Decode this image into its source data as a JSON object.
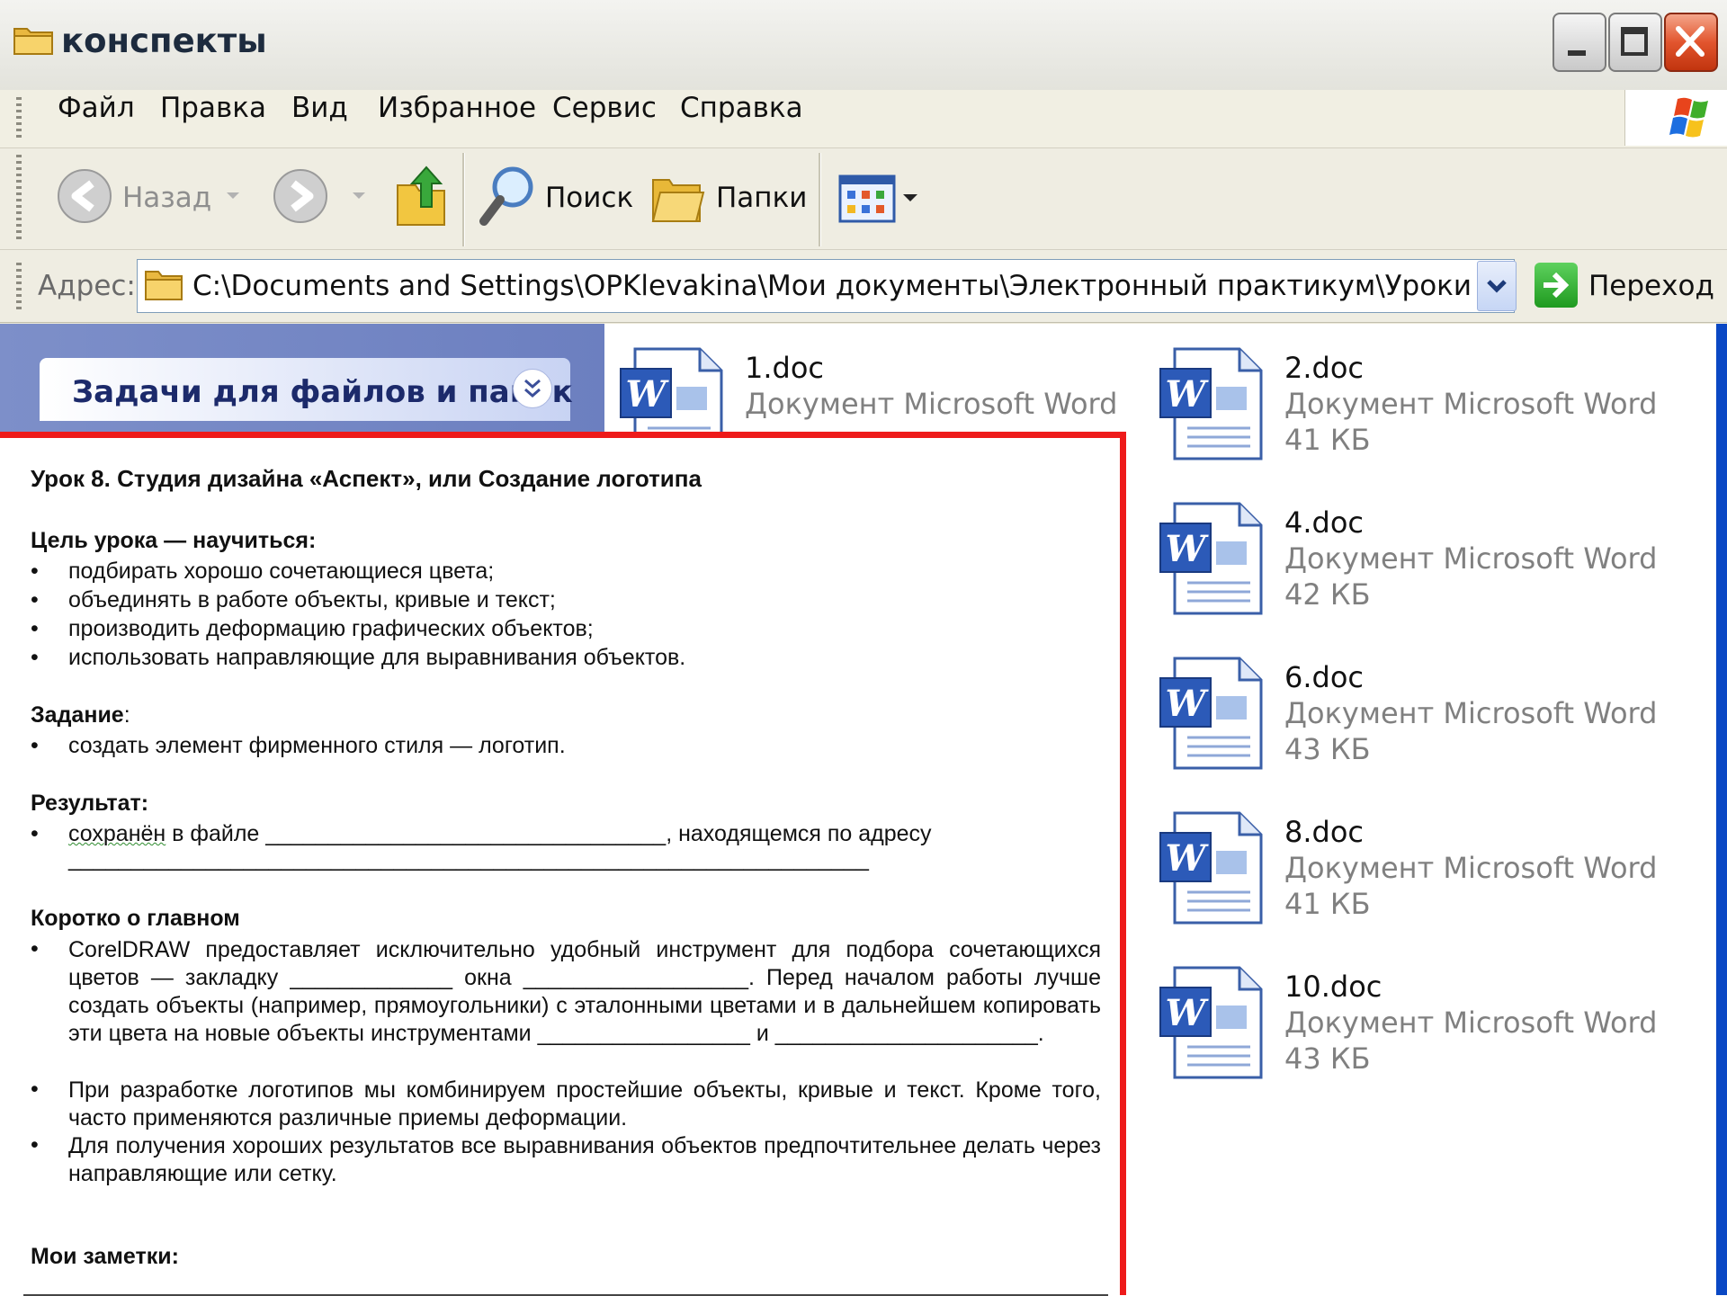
{
  "window": {
    "title": "конспекты"
  },
  "menu": {
    "items": [
      "Файл",
      "Правка",
      "Вид",
      "Избранное",
      "Сервис",
      "Справка"
    ]
  },
  "toolbar": {
    "back_label": "Назад",
    "search_label": "Поиск",
    "folders_label": "Папки"
  },
  "address": {
    "label": "Адрес:",
    "value": "C:\\Documents and Settings\\OPKlevakina\\Мои документы\\Электронный практикум\\Уроки CorelDRAW\\cd'",
    "go_label": "Переход"
  },
  "taskpane": {
    "title": "Задачи для файлов и папок"
  },
  "files": [
    {
      "name": "1.doc",
      "type": "Документ Microsoft Word",
      "size": ""
    },
    {
      "name": "2.doc",
      "type": "Документ Microsoft Word",
      "size": "41 КБ"
    },
    {
      "name": "4.doc",
      "type": "Документ Microsoft Word",
      "size": "42 КБ"
    },
    {
      "name": "6.doc",
      "type": "Документ Microsoft Word",
      "size": "43 КБ"
    },
    {
      "name": "8.doc",
      "type": "Документ Microsoft Word",
      "size": "41 КБ"
    },
    {
      "name": "10.doc",
      "type": "Документ Microsoft Word",
      "size": "43 КБ"
    }
  ],
  "document": {
    "title": "Урок 8. Студия дизайна «Аспект», или Создание логотипа",
    "goal_heading": "Цель урока — научиться:",
    "goal_items": [
      "подбирать хорошо сочетающиеся цвета;",
      "объединять в работе объекты, кривые и текст;",
      "производить деформацию графических объектов;",
      "использовать направляющие для выравнивания объектов."
    ],
    "task_heading": "Задание",
    "task_colon": ":",
    "task_items": [
      "создать элемент фирменного стиля — логотип."
    ],
    "result_heading": "Результат:",
    "result_word": "сохранён",
    "result_rest": " в файле ________________________________, находящемся по адресу",
    "result_line2": "________________________________________________________________",
    "summary_heading": "Коротко о главном",
    "summary_items": [
      "CorelDRAW предоставляет исключительно удобный инструмент для подбора сочетающихся цветов — закладку _____________ окна __________________. Перед началом работы лучше создать объекты (например, прямоугольники) с эталонными цветами и в дальнейшем копировать эти цвета на новые объекты инструментами _________________ и _____________________.",
      "При разработке логотипов мы комбинируем простейшие объекты, кривые и текст. Кроме того, часто применяются различные приемы деформации.",
      "Для получения хороших результатов все выравнивания объектов предпочтительнее делать через направляющие или сетку."
    ],
    "notes_heading": "Мои заметки:"
  },
  "colors": {
    "accent_red": "#ee1a1a",
    "xp_blue": "#0a48c4",
    "taskpane_blue": "#7d8fc9"
  }
}
